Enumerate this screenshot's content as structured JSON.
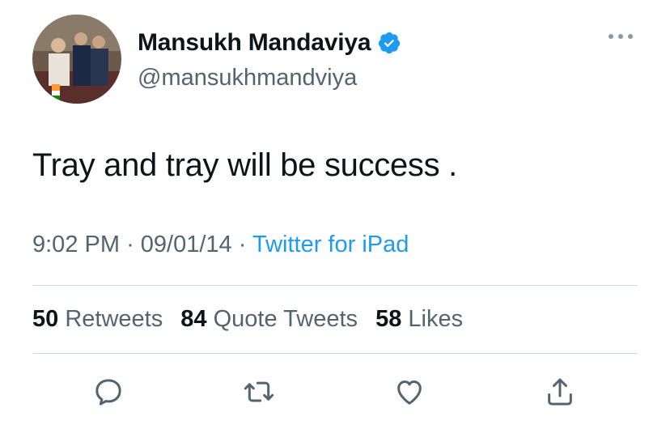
{
  "user": {
    "name": "Mansukh Mandaviya",
    "handle": "@mansukhmandviya",
    "verified": true,
    "avatar": "avatar-photo"
  },
  "tweet": {
    "text": "Tray and tray will be success ."
  },
  "meta": {
    "time": "9:02 PM",
    "separator": "·",
    "date": "09/01/14",
    "source": "Twitter for iPad"
  },
  "stats": {
    "retweets_count": "50",
    "retweets_label": "Retweets",
    "quotes_count": "84",
    "quotes_label": "Quote Tweets",
    "likes_count": "58",
    "likes_label": "Likes"
  },
  "actions": [
    {
      "icon": "reply-icon"
    },
    {
      "icon": "retweet-icon"
    },
    {
      "icon": "like-icon"
    },
    {
      "icon": "share-icon"
    }
  ],
  "colors": {
    "accent": "#1d9bf0",
    "secondary_text": "#536471",
    "primary_text": "#0f1419",
    "divider": "#cfd9de"
  }
}
